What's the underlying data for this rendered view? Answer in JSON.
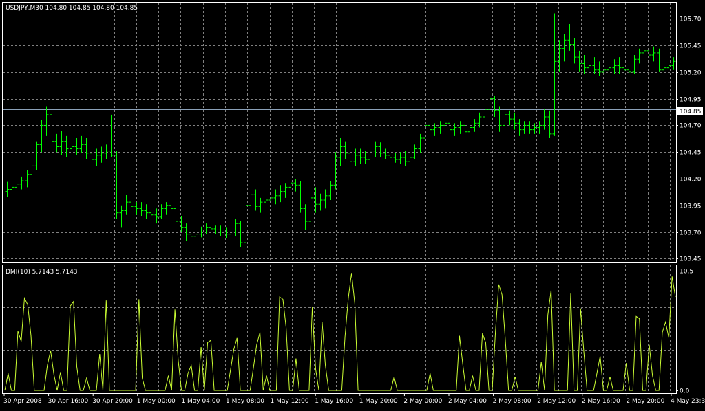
{
  "colors": {
    "background": "#000000",
    "grid": "#808080",
    "frame": "#ffffff",
    "bars": "#00ff00",
    "dmi_line": "#ccff33",
    "current_price_line": "#8aa0b8",
    "text": "#ffffff"
  },
  "header": {
    "main": "USDJPY,M30  104.80 104.85 104.80 104.85",
    "indicator": "DMI(10) 5.7143 5.7143"
  },
  "current_price_label": "104.85",
  "chart_data": [
    {
      "type": "bar",
      "subtype": "ohlc",
      "symbol": "USDJPY",
      "timeframe": "M30",
      "last_ohlc": {
        "open": 104.8,
        "high": 104.85,
        "low": 104.8,
        "close": 104.85
      },
      "current_price": 104.85,
      "ylim": [
        103.42,
        105.85
      ],
      "y_ticks": [
        "105.70",
        "105.45",
        "105.20",
        "104.95",
        "104.70",
        "104.45",
        "104.20",
        "103.95",
        "103.70",
        "103.45"
      ],
      "x_ticks": [
        "30 Apr 2008",
        "30 Apr 16:00",
        "30 Apr 20:00",
        "1 May 00:00",
        "1 May 04:00",
        "1 May 08:00",
        "1 May 12:00",
        "1 May 16:00",
        "1 May 20:00",
        "2 May 00:00",
        "2 May 04:00",
        "2 May 08:00",
        "2 May 12:00",
        "2 May 16:00",
        "2 May 20:00",
        "4 May 23:30"
      ],
      "grid": true,
      "ohlc": [
        [
          104.08,
          104.17,
          104.03,
          104.1
        ],
        [
          104.1,
          104.17,
          104.05,
          104.12
        ],
        [
          104.12,
          104.2,
          104.08,
          104.15
        ],
        [
          104.15,
          104.22,
          104.1,
          104.18
        ],
        [
          104.18,
          104.28,
          104.12,
          104.24
        ],
        [
          104.24,
          104.36,
          104.18,
          104.32
        ],
        [
          104.32,
          104.55,
          104.28,
          104.52
        ],
        [
          104.52,
          104.75,
          104.45,
          104.7
        ],
        [
          104.7,
          104.88,
          104.6,
          104.8
        ],
        [
          104.8,
          104.86,
          104.48,
          104.55
        ],
        [
          104.55,
          104.62,
          104.45,
          104.5
        ],
        [
          104.5,
          104.65,
          104.42,
          104.55
        ],
        [
          104.55,
          104.6,
          104.4,
          104.48
        ],
        [
          104.48,
          104.55,
          104.35,
          104.5
        ],
        [
          104.5,
          104.58,
          104.42,
          104.48
        ],
        [
          104.48,
          104.6,
          104.44,
          104.52
        ],
        [
          104.52,
          104.58,
          104.38,
          104.44
        ],
        [
          104.44,
          104.5,
          104.3,
          104.38
        ],
        [
          104.38,
          104.48,
          104.32,
          104.42
        ],
        [
          104.42,
          104.5,
          104.35,
          104.44
        ],
        [
          104.44,
          104.52,
          104.38,
          104.46
        ],
        [
          104.46,
          104.8,
          104.4,
          104.42
        ],
        [
          104.42,
          104.46,
          103.82,
          103.88
        ],
        [
          103.88,
          103.95,
          103.74,
          103.9
        ],
        [
          103.9,
          104.05,
          103.86,
          103.98
        ],
        [
          103.98,
          104.0,
          103.88,
          103.94
        ],
        [
          103.94,
          103.98,
          103.86,
          103.92
        ],
        [
          103.92,
          103.98,
          103.85,
          103.9
        ],
        [
          103.9,
          103.96,
          103.82,
          103.88
        ],
        [
          103.88,
          103.94,
          103.8,
          103.86
        ],
        [
          103.86,
          103.92,
          103.78,
          103.84
        ],
        [
          103.84,
          103.96,
          103.82,
          103.92
        ],
        [
          103.92,
          103.98,
          103.86,
          103.95
        ],
        [
          103.95,
          103.99,
          103.88,
          103.92
        ],
        [
          103.92,
          103.95,
          103.76,
          103.8
        ],
        [
          103.8,
          103.85,
          103.7,
          103.74
        ],
        [
          103.74,
          103.78,
          103.62,
          103.68
        ],
        [
          103.68,
          103.72,
          103.62,
          103.66
        ],
        [
          103.66,
          103.7,
          103.64,
          103.68
        ],
        [
          103.68,
          103.75,
          103.65,
          103.72
        ],
        [
          103.72,
          103.78,
          103.68,
          103.74
        ],
        [
          103.74,
          103.78,
          103.7,
          103.73
        ],
        [
          103.73,
          103.76,
          103.68,
          103.72
        ],
        [
          103.72,
          103.76,
          103.66,
          103.7
        ],
        [
          103.7,
          103.74,
          103.64,
          103.68
        ],
        [
          103.68,
          103.74,
          103.64,
          103.7
        ],
        [
          103.7,
          103.82,
          103.66,
          103.78
        ],
        [
          103.78,
          103.8,
          103.56,
          103.6
        ],
        [
          103.6,
          103.98,
          103.58,
          103.95
        ],
        [
          103.95,
          104.15,
          103.9,
          104.05
        ],
        [
          104.05,
          104.1,
          103.9,
          103.94
        ],
        [
          103.94,
          104.02,
          103.88,
          103.98
        ],
        [
          103.98,
          104.06,
          103.92,
          104.0
        ],
        [
          104.0,
          104.08,
          103.94,
          104.02
        ],
        [
          104.02,
          104.1,
          103.96,
          104.04
        ],
        [
          104.04,
          104.14,
          103.98,
          104.08
        ],
        [
          104.08,
          104.16,
          104.02,
          104.12
        ],
        [
          104.12,
          104.2,
          104.06,
          104.16
        ],
        [
          104.16,
          104.2,
          104.08,
          104.14
        ],
        [
          104.14,
          104.18,
          103.88,
          103.92
        ],
        [
          103.92,
          103.96,
          103.72,
          103.8
        ],
        [
          103.8,
          104.08,
          103.76,
          104.02
        ],
        [
          104.02,
          104.12,
          103.88,
          103.96
        ],
        [
          103.96,
          104.06,
          103.9,
          104.0
        ],
        [
          104.0,
          104.1,
          103.92,
          104.04
        ],
        [
          104.04,
          104.18,
          104.0,
          104.14
        ],
        [
          104.14,
          104.45,
          104.1,
          104.4
        ],
        [
          104.4,
          104.58,
          104.32,
          104.5
        ],
        [
          104.5,
          104.55,
          104.38,
          104.44
        ],
        [
          104.44,
          104.52,
          104.3,
          104.36
        ],
        [
          104.36,
          104.48,
          104.32,
          104.42
        ],
        [
          104.42,
          104.48,
          104.34,
          104.4
        ],
        [
          104.4,
          104.46,
          104.34,
          104.38
        ],
        [
          104.38,
          104.5,
          104.34,
          104.46
        ],
        [
          104.46,
          104.55,
          104.4,
          104.5
        ],
        [
          104.5,
          104.54,
          104.4,
          104.44
        ],
        [
          104.44,
          104.48,
          104.38,
          104.42
        ],
        [
          104.42,
          104.46,
          104.36,
          104.4
        ],
        [
          104.4,
          104.44,
          104.35,
          104.38
        ],
        [
          104.38,
          104.45,
          104.34,
          104.4
        ],
        [
          104.4,
          104.46,
          104.32,
          104.36
        ],
        [
          104.36,
          104.44,
          104.32,
          104.4
        ],
        [
          104.4,
          104.52,
          104.38,
          104.48
        ],
        [
          104.48,
          104.62,
          104.44,
          104.58
        ],
        [
          104.58,
          104.8,
          104.54,
          104.7
        ],
        [
          104.7,
          104.76,
          104.62,
          104.66
        ],
        [
          104.66,
          104.72,
          104.6,
          104.68
        ],
        [
          104.68,
          104.74,
          104.62,
          104.7
        ],
        [
          104.7,
          104.76,
          104.64,
          104.72
        ],
        [
          104.72,
          104.76,
          104.6,
          104.66
        ],
        [
          104.66,
          104.72,
          104.6,
          104.68
        ],
        [
          104.68,
          104.74,
          104.62,
          104.7
        ],
        [
          104.7,
          104.74,
          104.6,
          104.64
        ],
        [
          104.64,
          104.72,
          104.58,
          104.68
        ],
        [
          104.68,
          104.76,
          104.64,
          104.72
        ],
        [
          104.72,
          104.82,
          104.68,
          104.78
        ],
        [
          104.78,
          104.92,
          104.72,
          104.85
        ],
        [
          104.85,
          105.03,
          104.8,
          104.95
        ],
        [
          104.95,
          104.98,
          104.78,
          104.84
        ],
        [
          104.84,
          104.88,
          104.64,
          104.7
        ],
        [
          104.7,
          104.84,
          104.66,
          104.8
        ],
        [
          104.8,
          104.84,
          104.7,
          104.76
        ],
        [
          104.76,
          104.82,
          104.66,
          104.72
        ],
        [
          104.72,
          104.76,
          104.6,
          104.66
        ],
        [
          104.66,
          104.74,
          104.62,
          104.7
        ],
        [
          104.7,
          104.74,
          104.62,
          104.66
        ],
        [
          104.66,
          104.72,
          104.62,
          104.68
        ],
        [
          104.68,
          104.74,
          104.62,
          104.7
        ],
        [
          104.7,
          104.85,
          104.66,
          104.78
        ],
        [
          104.78,
          104.84,
          104.58,
          104.62
        ],
        [
          104.62,
          105.75,
          104.6,
          105.3
        ],
        [
          105.3,
          105.5,
          105.2,
          105.42
        ],
        [
          105.42,
          105.56,
          105.3,
          105.5
        ],
        [
          105.5,
          105.65,
          105.4,
          105.46
        ],
        [
          105.46,
          105.52,
          105.28,
          105.34
        ],
        [
          105.34,
          105.4,
          105.2,
          105.28
        ],
        [
          105.28,
          105.36,
          105.18,
          105.24
        ],
        [
          105.24,
          105.32,
          105.16,
          105.26
        ],
        [
          105.26,
          105.34,
          105.18,
          105.22
        ],
        [
          105.22,
          105.3,
          105.16,
          105.2
        ],
        [
          105.2,
          105.28,
          105.16,
          105.22
        ],
        [
          105.22,
          105.3,
          105.14,
          105.24
        ],
        [
          105.24,
          105.32,
          105.18,
          105.26
        ],
        [
          105.26,
          105.34,
          105.18,
          105.24
        ],
        [
          105.24,
          105.3,
          105.16,
          105.22
        ],
        [
          105.22,
          105.28,
          105.16,
          105.2
        ],
        [
          105.2,
          105.36,
          105.18,
          105.32
        ],
        [
          105.32,
          105.42,
          105.28,
          105.38
        ],
        [
          105.38,
          105.46,
          105.32,
          105.4
        ],
        [
          105.4,
          105.48,
          105.34,
          105.36
        ],
        [
          105.36,
          105.44,
          105.3,
          105.38
        ],
        [
          105.38,
          105.42,
          105.2,
          105.22
        ],
        [
          105.22,
          105.26,
          105.18,
          105.24
        ],
        [
          105.24,
          105.3,
          105.2,
          105.26
        ],
        [
          105.26,
          105.34,
          105.22,
          105.3
        ]
      ]
    },
    {
      "type": "line",
      "series_label": "DMI(10)",
      "values_shown": [
        5.7143,
        5.7143
      ],
      "ylim": [
        0,
        10.5
      ],
      "y_ticks": [
        "10.5",
        "0.0"
      ],
      "values": [
        0,
        1.5,
        0,
        0,
        5.2,
        4.3,
        8.1,
        7.5,
        4.8,
        0,
        0,
        0,
        0,
        2.2,
        3.5,
        1.4,
        0,
        1.6,
        0,
        0,
        7.4,
        7.8,
        2.1,
        0,
        0,
        1.1,
        0,
        0,
        0,
        3.2,
        0,
        7.9,
        0,
        0,
        0,
        0,
        0,
        0,
        0,
        0,
        0,
        8.0,
        1.1,
        0,
        0,
        0,
        0,
        0,
        0,
        0,
        1.3,
        0,
        7.1,
        2.7,
        0,
        0,
        1.5,
        2.2,
        0,
        0,
        3.8,
        0,
        4.2,
        4.4,
        0,
        0,
        0,
        0,
        0,
        1.8,
        3.6,
        4.6,
        0,
        0,
        0,
        0,
        2.0,
        4.0,
        5.1,
        0,
        1.3,
        0,
        0,
        0,
        8.2,
        8.0,
        5.5,
        0,
        0,
        2.8,
        0,
        0,
        0,
        0,
        7.3,
        1.9,
        0,
        6.0,
        2.2,
        0,
        0,
        0,
        0,
        0,
        4.7,
        8.1,
        10.3,
        7.6,
        0,
        0,
        0,
        0,
        0,
        0,
        0,
        0,
        0,
        0,
        0,
        1.2,
        0,
        0,
        0,
        0,
        0,
        0,
        0,
        0,
        0,
        0,
        1.5,
        0,
        0,
        0,
        0,
        0,
        0,
        0,
        0,
        4.8,
        2.3,
        0,
        0,
        1.3,
        0,
        0,
        5.0,
        4.2,
        0,
        0,
        5.2,
        9.3,
        8.4,
        4.5,
        0,
        0,
        1.2,
        0,
        0,
        0,
        0,
        0,
        0,
        0,
        2.5,
        0,
        6.6,
        8.8,
        0,
        0,
        0,
        0,
        0,
        8.5,
        0,
        0,
        7.2,
        3.4,
        0,
        0,
        0,
        1.5,
        3.0,
        0,
        0,
        1.2,
        0,
        0,
        0,
        0,
        2.4,
        0,
        0,
        6.5,
        6.3,
        0,
        0,
        4.0,
        1.3,
        0,
        0,
        5.1,
        6.0,
        4.6,
        10.0,
        8.2
      ]
    }
  ]
}
